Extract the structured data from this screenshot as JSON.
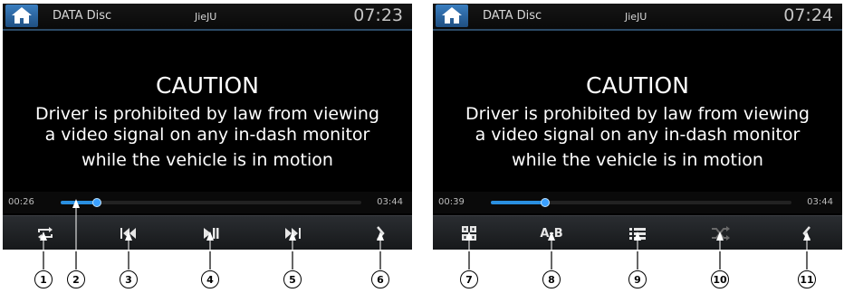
{
  "left_screen": {
    "header": {
      "source": "DATA Disc",
      "track": "JieJU",
      "clock": "07:23"
    },
    "caution": {
      "title": "CAUTION",
      "lines": [
        "Driver is prohibited by law from viewing",
        "a video signal on any in-dash monitor",
        "while the vehicle is in motion"
      ]
    },
    "progress": {
      "elapsed": "00:26",
      "total": "03:44",
      "fraction": 0.12
    },
    "controls": [
      {
        "name": "repeat-icon"
      },
      {
        "name": "previous-track-icon"
      },
      {
        "name": "play-pause-icon"
      },
      {
        "name": "next-track-icon"
      },
      {
        "name": "more-right-icon"
      }
    ]
  },
  "right_screen": {
    "header": {
      "source": "DATA Disc",
      "track": "JieJU",
      "clock": "07:24"
    },
    "caution": {
      "title": "CAUTION",
      "lines": [
        "Driver is prohibited by law from viewing",
        "a video signal on any in-dash monitor",
        "while the vehicle is in motion"
      ]
    },
    "progress": {
      "elapsed": "00:39",
      "total": "03:44",
      "fraction": 0.18
    },
    "controls": [
      {
        "name": "numeric-keypad-icon"
      },
      {
        "name": "ab-repeat-button",
        "label": "A-B"
      },
      {
        "name": "playlist-icon"
      },
      {
        "name": "shuffle-icon"
      },
      {
        "name": "back-left-icon"
      }
    ]
  },
  "callouts": [
    "1",
    "2",
    "3",
    "4",
    "5",
    "6",
    "7",
    "8",
    "9",
    "10",
    "11"
  ],
  "colors": {
    "accent": "#2a8fe0",
    "home_button": "#2f6eab",
    "background": "#000000"
  }
}
